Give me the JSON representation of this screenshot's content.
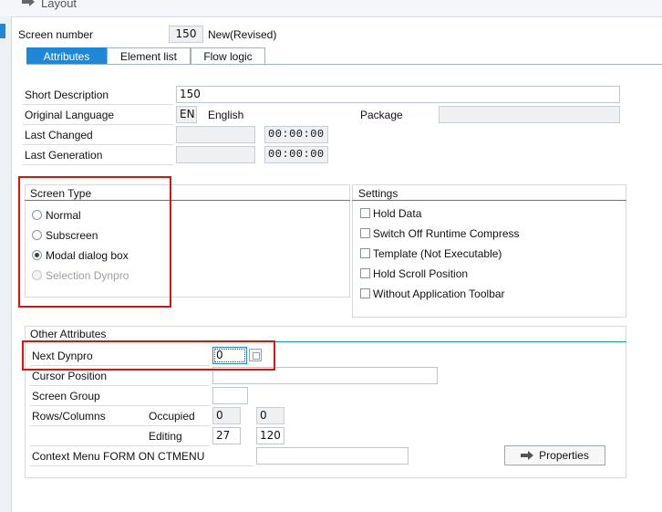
{
  "window": {
    "title": "Layout"
  },
  "header": {
    "screen_number_label": "Screen number",
    "screen_number_value": "150",
    "status_text": "New(Revised)"
  },
  "tabs": [
    {
      "label": "Attributes",
      "active": true
    },
    {
      "label": "Element list",
      "active": false
    },
    {
      "label": "Flow logic",
      "active": false
    }
  ],
  "attributes": {
    "short_description": {
      "label": "Short Description",
      "value": "150"
    },
    "original_language": {
      "label": "Original Language",
      "code": "EN",
      "name": "English"
    },
    "package": {
      "label": "Package",
      "value": ""
    },
    "last_changed": {
      "label": "Last Changed",
      "date": "",
      "time": "00:00:00"
    },
    "last_generation": {
      "label": "Last Generation",
      "date": "",
      "time": "00:00:00"
    }
  },
  "screen_type": {
    "title": "Screen Type",
    "options": [
      {
        "label": "Normal",
        "selected": false,
        "disabled": false
      },
      {
        "label": "Subscreen",
        "selected": false,
        "disabled": false
      },
      {
        "label": "Modal dialog box",
        "selected": true,
        "disabled": false
      },
      {
        "label": "Selection Dynpro",
        "selected": false,
        "disabled": true
      }
    ]
  },
  "settings": {
    "title": "Settings",
    "options": [
      {
        "label": "Hold Data",
        "checked": false
      },
      {
        "label": "Switch Off Runtime Compress",
        "checked": false
      },
      {
        "label": "Template (Not Executable)",
        "checked": false
      },
      {
        "label": "Hold Scroll Position",
        "checked": false
      },
      {
        "label": "Without Application Toolbar",
        "checked": false
      }
    ]
  },
  "other_attributes": {
    "title": "Other Attributes",
    "next_dynpro": {
      "label": "Next Dynpro",
      "value": "0"
    },
    "cursor_position": {
      "label": "Cursor Position",
      "value": ""
    },
    "screen_group": {
      "label": "Screen Group",
      "value": ""
    },
    "rows_columns": {
      "label": "Rows/Columns",
      "occupied_label": "Occupied",
      "occupied_rows": "0",
      "occupied_cols": "0",
      "editing_label": "Editing",
      "editing_rows": "27",
      "editing_cols": "120"
    },
    "context_menu": {
      "label": "Context Menu FORM ON CTMENU",
      "value": ""
    },
    "properties_button": "Properties"
  },
  "colors": {
    "accent": "#1e88d6",
    "highlight": "#e01010"
  }
}
